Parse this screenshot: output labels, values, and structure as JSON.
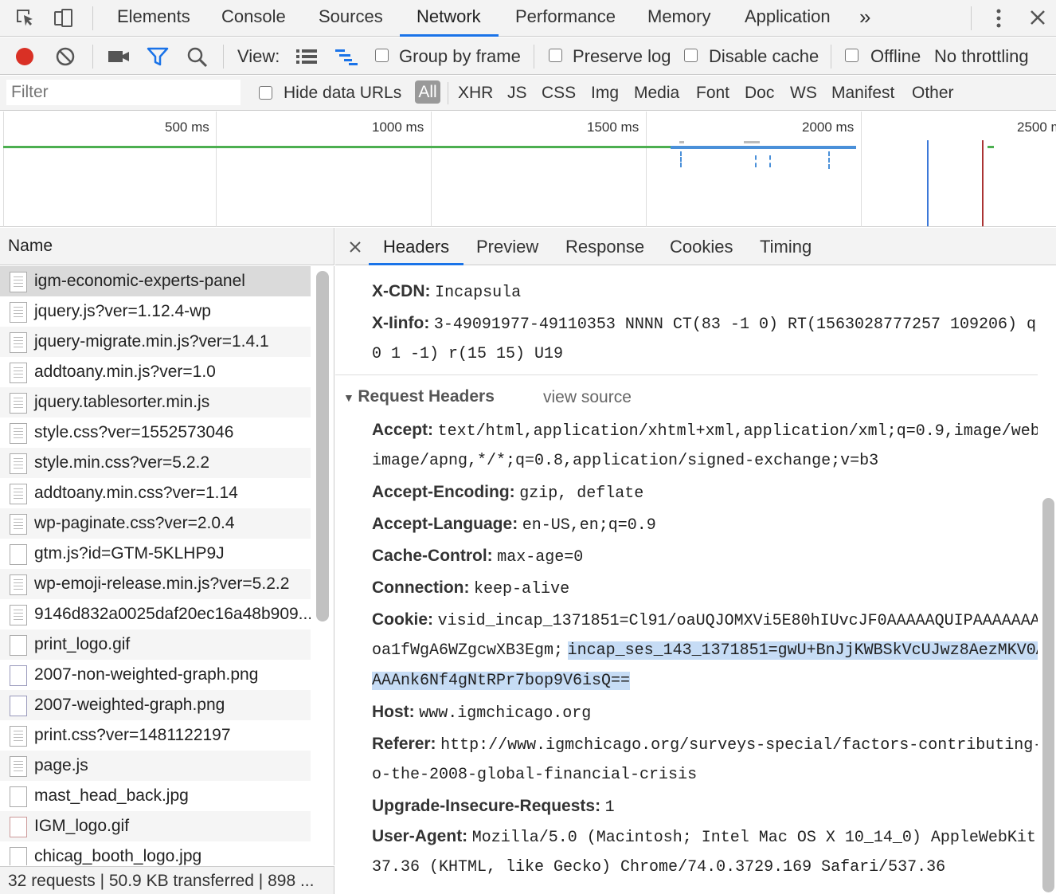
{
  "tabs": {
    "elements": "Elements",
    "console": "Console",
    "sources": "Sources",
    "network": "Network",
    "performance": "Performance",
    "memory": "Memory",
    "application": "Application"
  },
  "toolbar": {
    "view_label": "View:",
    "group_by_frame": "Group by frame",
    "preserve_log": "Preserve log",
    "disable_cache": "Disable cache",
    "offline": "Offline",
    "throttling": "No throttling"
  },
  "filterbar": {
    "placeholder": "Filter",
    "hide_data_urls": "Hide data URLs",
    "types": [
      "All",
      "XHR",
      "JS",
      "CSS",
      "Img",
      "Media",
      "Font",
      "Doc",
      "WS",
      "Manifest",
      "Other"
    ]
  },
  "overview": {
    "ticks": [
      "500 ms",
      "1000 ms",
      "1500 ms",
      "2000 ms",
      "2500 ms"
    ]
  },
  "requests": {
    "header": "Name",
    "items": [
      "igm-economic-experts-panel",
      "jquery.js?ver=1.12.4-wp",
      "jquery-migrate.min.js?ver=1.4.1",
      "addtoany.min.js?ver=1.0",
      "jquery.tablesorter.min.js",
      "style.css?ver=1552573046",
      "style.min.css?ver=5.2.2",
      "addtoany.min.css?ver=1.14",
      "wp-paginate.css?ver=2.0.4",
      "gtm.js?id=GTM-5KLHP9J",
      "wp-emoji-release.min.js?ver=5.2.2",
      "9146d832a0025daf20ec16a48b909...",
      "print_logo.gif",
      "2007-non-weighted-graph.png",
      "2007-weighted-graph.png",
      "print.css?ver=1481122197",
      "page.js",
      "mast_head_back.jpg",
      "IGM_logo.gif",
      "chicag_booth_logo.jpg"
    ],
    "status": "32 requests | 50.9 KB transferred | 898 ..."
  },
  "detail_tabs": {
    "headers": "Headers",
    "preview": "Preview",
    "response": "Response",
    "cookies": "Cookies",
    "timing": "Timing"
  },
  "response_headers": {
    "x_cdn_key": "X-CDN:",
    "x_cdn_val": "Incapsula",
    "x_iinfo_key": "X-Iinfo:",
    "x_iinfo_val1": "3-49091977-49110353 NNNN CT(83 -1 0) RT(1563028777257 109206) q",
    "x_iinfo_val2": "0 1 -1) r(15 15) U19"
  },
  "request_headers": {
    "title": "Request Headers",
    "view_source": "view source",
    "accept_key": "Accept:",
    "accept_val1": "text/html,application/xhtml+xml,application/xml;q=0.9,image/web",
    "accept_val2": "image/apng,*/*;q=0.8,application/signed-exchange;v=b3",
    "accept_encoding_key": "Accept-Encoding:",
    "accept_encoding_val": "gzip, deflate",
    "accept_language_key": "Accept-Language:",
    "accept_language_val": "en-US,en;q=0.9",
    "cache_control_key": "Cache-Control:",
    "cache_control_val": "max-age=0",
    "connection_key": "Connection:",
    "connection_val": "keep-alive",
    "cookie_key": "Cookie:",
    "cookie_val1": "visid_incap_1371851=Cl91/oaUQJOMXVi5E80hIUvcJF0AAAAAQUIPAAAAAAA",
    "cookie_val2a": "oa1fWgA6WZgcwXB3Egm;",
    "cookie_val2b": "incap_ses_143_1371851=gwU+BnJjKWBSkVcUJwz8AezMKV0A",
    "cookie_val3": "AAAnk6Nf4gNtRPr7bop9V6isQ==",
    "host_key": "Host:",
    "host_val": "www.igmchicago.org",
    "referer_key": "Referer:",
    "referer_val1": "http://www.igmchicago.org/surveys-special/factors-contributing-",
    "referer_val2": "o-the-2008-global-financial-crisis",
    "upgrade_key": "Upgrade-Insecure-Requests:",
    "upgrade_val": "1",
    "user_agent_key": "User-Agent:",
    "user_agent_val1": "Mozilla/5.0 (Macintosh; Intel Mac OS X 10_14_0) AppleWebKit",
    "user_agent_val2": "37.36 (KHTML, like Gecko) Chrome/74.0.3729.169 Safari/537.36"
  },
  "colors": {
    "record": "#d93025",
    "accent": "#1a73e8",
    "selection": "#c6dcf5",
    "timeline_green": "#4caf50",
    "timeline_blue": "#4a90d9"
  }
}
